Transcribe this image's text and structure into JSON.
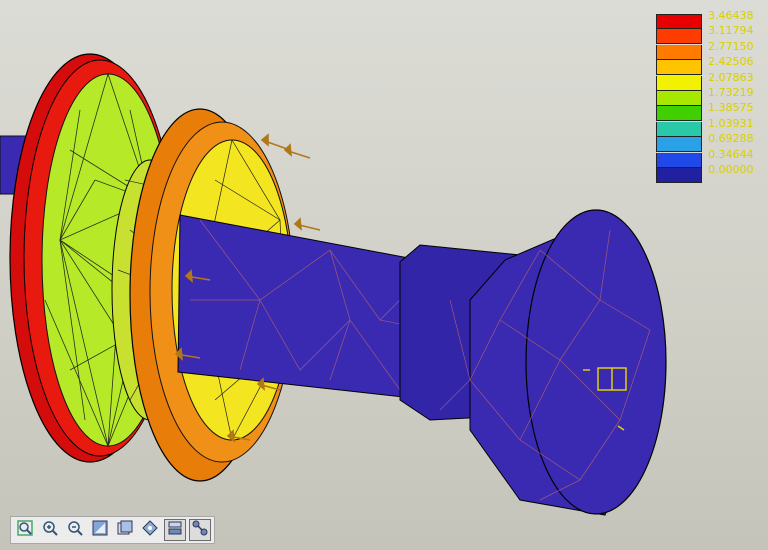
{
  "legend": {
    "items": [
      {
        "value": "3.46438",
        "color": "#e80000"
      },
      {
        "value": "3.11794",
        "color": "#ff3c00"
      },
      {
        "value": "2.77150",
        "color": "#ff7a00"
      },
      {
        "value": "2.42506",
        "color": "#ffc400"
      },
      {
        "value": "2.07863",
        "color": "#f2f200"
      },
      {
        "value": "1.73219",
        "color": "#a8e800"
      },
      {
        "value": "1.38575",
        "color": "#40d000"
      },
      {
        "value": "1.03931",
        "color": "#28c8a8"
      },
      {
        "value": "0.69288",
        "color": "#2aa0e6"
      },
      {
        "value": "0.34644",
        "color": "#1f4ae8"
      },
      {
        "value": "0.00000",
        "color": "#2020a0"
      }
    ]
  },
  "colors": {
    "low": "#3a2ab2",
    "mesh_low": "#b06070",
    "outer_disk_rim": "#e81010",
    "outer_disk_face": "#b6ea28",
    "mid_disk": "#f19016",
    "mid_disk_face": "#f3e520",
    "load_arrow": "#b07818"
  },
  "toolbar": {
    "buttons": [
      {
        "icon": "zoom-fit-icon",
        "active": false
      },
      {
        "icon": "zoom-in-icon",
        "active": false
      },
      {
        "icon": "zoom-out-icon",
        "active": false
      },
      {
        "icon": "refit-icon",
        "active": false
      },
      {
        "icon": "named-view-icon",
        "active": false
      },
      {
        "icon": "orient-icon",
        "active": false
      },
      {
        "icon": "layer-icon",
        "active": true
      },
      {
        "icon": "spin-center-icon",
        "active": true
      }
    ]
  }
}
